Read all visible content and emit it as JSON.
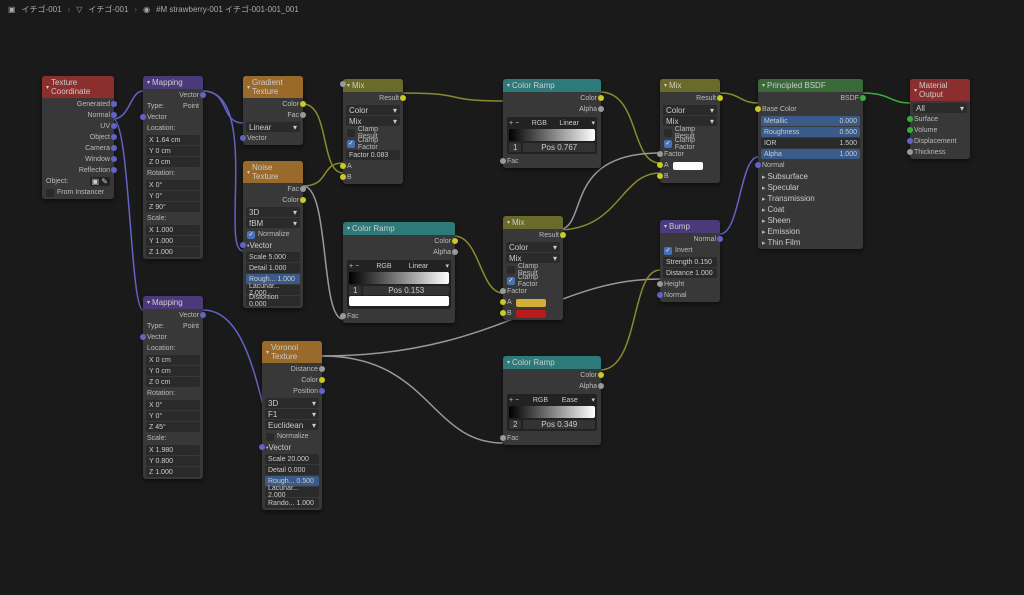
{
  "breadcrumb": {
    "a": "イチゴ-001",
    "b": "イチゴ-001",
    "c": "#M strawberry-001 イチゴ-001-001_001"
  },
  "nodes": {
    "texcoord": {
      "title": "Texture Coordinate",
      "outs": [
        "Generated",
        "Normal",
        "UV",
        "Object",
        "Camera",
        "Window",
        "Reflection"
      ],
      "object": "Object:",
      "fromInst": "From Instancer"
    },
    "mapping1": {
      "title": "Mapping",
      "out": "Vector",
      "type": "Type:",
      "typeVal": "Point",
      "vector": "Vector",
      "location": "Location:",
      "rotation": "Rotation:",
      "scale": "Scale:",
      "loc": {
        "x": "X    1.64 cm",
        "y": "Y       0 cm",
        "z": "Z       0 cm"
      },
      "rot": {
        "x": "X         0°",
        "y": "Y         0°",
        "z": "Z        90°"
      },
      "scl": {
        "x": "X      1.000",
        "y": "Y      1.000",
        "z": "Z      1.000"
      }
    },
    "mapping2": {
      "title": "Mapping",
      "out": "Vector",
      "type": "Type:",
      "typeVal": "Point",
      "vector": "Vector",
      "location": "Location:",
      "rotation": "Rotation:",
      "scale": "Scale:",
      "loc": {
        "x": "X       0 cm",
        "y": "Y       0 cm",
        "z": "Z       0 cm"
      },
      "rot": {
        "x": "X         0°",
        "y": "Y         0°",
        "z": "Z        45°"
      },
      "scl": {
        "x": "X      1.980",
        "y": "Y      0.800",
        "z": "Z      1.000"
      }
    },
    "gradient": {
      "title": "Gradient Texture",
      "outs": [
        "Color",
        "Fac"
      ],
      "mode": "Linear",
      "vector": "Vector"
    },
    "noise": {
      "title": "Noise Texture",
      "outs": [
        "Fac",
        "Color"
      ],
      "dim": "3D",
      "fbm": "fBM",
      "normalize": "Normalize",
      "vector": "Vector",
      "scale": "Scale    5.000",
      "detail": "Detail    1.000",
      "rough": "Rough...   1.000",
      "lacun": "Lacunar... 2.000",
      "distort": "Distortion 0.000"
    },
    "voronoi": {
      "title": "Voronoi Texture",
      "outs": [
        "Distance",
        "Color",
        "Position"
      ],
      "dim": "3D",
      "f": "F1",
      "dist": "Euclidean",
      "normalize": "Normalize",
      "vector": "Vector",
      "scale": "Scale   20.000",
      "detail": "Detail    0.000",
      "rough": "Rough...   0.500",
      "lacun": "Lacunar... 2.000",
      "rand": "Rando...  1.000"
    },
    "mix1": {
      "title": "Mix",
      "result": "Result",
      "color": "Color",
      "mix": "Mix",
      "clampResult": "Clamp Result",
      "clampFactor": "Clamp Factor",
      "factor": "Factor   0.083",
      "a": "A",
      "b": "B"
    },
    "mix2": {
      "title": "Mix",
      "result": "Result",
      "color": "Color",
      "mix": "Mix",
      "clampResult": "Clamp Result",
      "clampFactor": "Clamp Factor",
      "factor": "Factor",
      "a": "A",
      "b": "B"
    },
    "mix3": {
      "title": "Mix",
      "result": "Result",
      "color": "Color",
      "mix": "Mix",
      "clampResult": "Clamp Result",
      "clampFactor": "Clamp Factor",
      "factor": "Factor",
      "a": "A",
      "b": "B"
    },
    "ramp1": {
      "title": "Color Ramp",
      "color": "Color",
      "alpha": "Alpha",
      "mode1": "RGB",
      "mode2": "Linear",
      "pos": "Pos",
      "posVal": "0.767",
      "idx": "1",
      "fac": "Fac"
    },
    "ramp2": {
      "title": "Color Ramp",
      "color": "Color",
      "alpha": "Alpha",
      "mode1": "RGB",
      "mode2": "Linear",
      "pos": "Pos",
      "posVal": "0.153",
      "idx": "1",
      "fac": "Fac"
    },
    "ramp3": {
      "title": "Color Ramp",
      "color": "Color",
      "alpha": "Alpha",
      "mode1": "RGB",
      "mode2": "Ease",
      "pos": "Pos",
      "posVal": "0.349",
      "idx": "2",
      "fac": "Fac"
    },
    "bump": {
      "title": "Bump",
      "normal": "Normal",
      "invert": "Invert",
      "strength": "Strength  0.150",
      "distance": "Distance  1.000",
      "height": "Height",
      "normalIn": "Normal"
    },
    "bsdf": {
      "title": "Principled BSDF",
      "bsdf": "BSDF",
      "baseColor": "Base Color",
      "metallic": "Metallic",
      "metallicV": "0.000",
      "roughness": "Roughness",
      "roughnessV": "0.500",
      "ior": "IOR",
      "iorV": "1.500",
      "alpha": "Alpha",
      "alphaV": "1.000",
      "normal": "Normal",
      "groups": [
        "Subsurface",
        "Specular",
        "Transmission",
        "Coat",
        "Sheen",
        "Emission",
        "Thin Film"
      ]
    },
    "output": {
      "title": "Material Output",
      "all": "All",
      "surface": "Surface",
      "volume": "Volume",
      "displacement": "Displacement",
      "thickness": "Thickness"
    }
  }
}
